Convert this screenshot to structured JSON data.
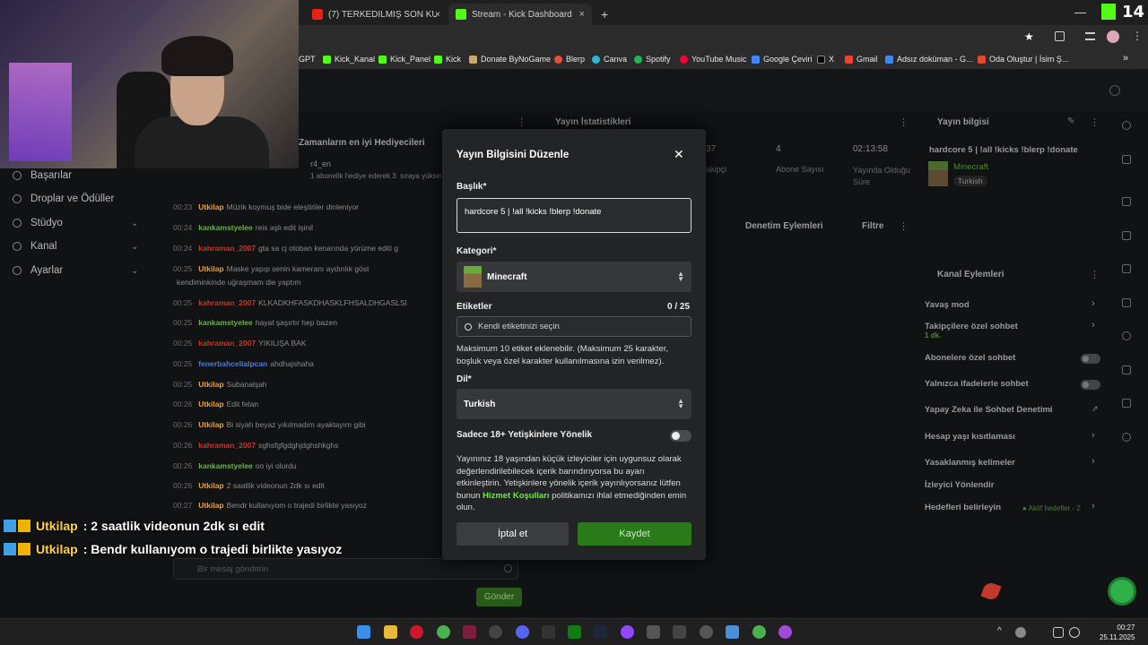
{
  "browser": {
    "tabs": [
      {
        "label": "(7) TERKEDİLMİŞ SON KULEYE V",
        "close": "×"
      },
      {
        "label": "Stream - Kick Dashboard",
        "close": "×"
      }
    ],
    "new_tab": "+",
    "kick_counter": "14",
    "window_controls": {
      "minimize": "—",
      "maximize": "☐",
      "close": "✕"
    },
    "bookmarks": [
      "GPT",
      "Kick_Kanal",
      "Kick_Panel",
      "Kick",
      "Donate ByNoGame",
      "Blerp",
      "Canva",
      "Spotify",
      "YouTube Music",
      "Google Çeviri",
      "X",
      "Gmail",
      "Adsız doküman - G...",
      "Oda Oluştur | İsim Ş..."
    ],
    "bookmarks_more": "»"
  },
  "dashboard": {
    "panels": {
      "gifters": "Zamanların en iyi Hediyecileri",
      "stats": "Yayın İstatistikleri",
      "info": "Yayın bilgisi",
      "moderation": "Denetim Eylemleri",
      "filter": "Filtre",
      "channel_actions": "Kanal Eylemleri"
    },
    "gifter_name": "r4_en",
    "gifter_note": "1 abonelik hediye ederek 3. sıraya yükseldi",
    "stats": [
      {
        "value": "4",
        "label": "Abone Sayısı"
      },
      {
        "value": "02:13:58",
        "label": "Yayında Olduğu Süre"
      }
    ],
    "stats_fragment": {
      "value": "37",
      "label": "akipçi"
    },
    "stream_info": {
      "title": "hardcore 5 | !all !kicks !blerp !donate",
      "category": "Minecraft",
      "language": "Turkish"
    },
    "nav": [
      {
        "label": "Başarılar",
        "chevron": ""
      },
      {
        "label": "Droplar ve Ödüller",
        "chevron": ""
      },
      {
        "label": "Stüdyo",
        "chevron": "⌄"
      },
      {
        "label": "Kanal",
        "chevron": "⌄"
      },
      {
        "label": "Ayarlar",
        "chevron": "⌄"
      }
    ],
    "chat": [
      {
        "time": "00:23",
        "user": "Utkilap",
        "color": "#e8a13a",
        "msg": "Müzik koymuş bide eleştiriler dinleniyor"
      },
      {
        "time": "00:24",
        "user": "kankamstyelee",
        "color": "#6ab04c",
        "msg": "reis aşlı edit işinil"
      },
      {
        "time": "00:24",
        "user": "kahraman_2007",
        "color": "#c0392b",
        "msg": "gta sa cj otoban kenarında yürüme editi g"
      },
      {
        "time": "00:25",
        "user": "Utkilap",
        "color": "#e8a13a",
        "msg": "Maske yapıp senin kameranı aydınlık göst"
      },
      {
        "time": "",
        "user": "",
        "color": "#8a8a8a",
        "msg": "kendiminkinde uğraşmam die yaptım"
      },
      {
        "time": "00:25",
        "user": "kahraman_2007",
        "color": "#c0392b",
        "msg": "KLKADKHFASKDHASKLFHSALDHGASLSI"
      },
      {
        "time": "00:25",
        "user": "kankamstyelee",
        "color": "#6ab04c",
        "msg": "hayat şaşırtır hep bazen"
      },
      {
        "time": "00:25",
        "user": "kahraman_2007",
        "color": "#c0392b",
        "msg": "YIKILIŞA BAK"
      },
      {
        "time": "00:25",
        "user": "fenerbahcelialpcan",
        "color": "#4c7bd9",
        "msg": "ahdhajshaha"
      },
      {
        "time": "00:25",
        "user": "Utkilap",
        "color": "#e8a13a",
        "msg": "Subanalşah"
      },
      {
        "time": "00:26",
        "user": "Utkilap",
        "color": "#e8a13a",
        "msg": "Edit felan"
      },
      {
        "time": "00:26",
        "user": "Utkilap",
        "color": "#e8a13a",
        "msg": "Bi siyah beyaz yıkılmadım ayaktayım gibi"
      },
      {
        "time": "00:26",
        "user": "kahraman_2007",
        "color": "#c0392b",
        "msg": "sghsfgfgdghjdghshkghs"
      },
      {
        "time": "00:26",
        "user": "kankamstyelee",
        "color": "#6ab04c",
        "msg": "oo iyi olurdu"
      },
      {
        "time": "00:26",
        "user": "Utkilap",
        "color": "#e8a13a",
        "msg": "2 saatlik videonun 2dk sı edit"
      },
      {
        "time": "00:27",
        "user": "Utkilap",
        "color": "#e8a13a",
        "msg": "Bendr kullanıyom o trajedi birlikte yasıyoz"
      }
    ],
    "chat_input_placeholder": "Bir mesaj gönderin",
    "chat_send": "Gönder",
    "channel_actions": [
      {
        "label": "Yavaş mod",
        "sub": "",
        "control": "arrow"
      },
      {
        "label": "Takipçilere özel sohbet",
        "sub": "1 dk.",
        "control": "arrow"
      },
      {
        "label": "Abonelere özel sohbet",
        "sub": "",
        "control": "toggle"
      },
      {
        "label": "Yalnızca ifadelerle sohbet",
        "sub": "",
        "control": "toggle"
      },
      {
        "label": "Yapay Zeka ile Sohbet Denetimi",
        "sub": "",
        "control": "icon"
      },
      {
        "label": "Hesap yaşı kısıtlaması",
        "sub": "",
        "control": "arrow"
      },
      {
        "label": "Yasaklanmış kelimeler",
        "sub": "",
        "control": "arrow"
      },
      {
        "label": "İzleyici Yönlendir",
        "sub": "",
        "control": "none"
      },
      {
        "label": "Hedefleri belirleyin",
        "sub": "",
        "control": "arrow"
      }
    ],
    "goal_status": "Aktif hedefler - 2"
  },
  "overlay": {
    "chat": [
      {
        "user": "Utkilap",
        "msg": ": 2 saatlik videonun 2dk sı edit"
      },
      {
        "user": "Utkilap",
        "msg": ": Bendr kullanıyom o trajedi birlikte yasıyoz"
      }
    ]
  },
  "modal": {
    "title": "Yayın Bilgisini Düzenle",
    "close": "✕",
    "title_label": "Başlık*",
    "title_value": "hardcore 5 | !all !kicks !blerp !donate",
    "category_label": "Kategori*",
    "category_value": "Minecraft",
    "tags_label": "Etiketler",
    "tags_count": "0 / 25",
    "tags_placeholder": "Kendi etiketinizi seçin",
    "tags_help": "Maksimum 10 etiket eklenebilir. (Maksimum 25 karakter, boşluk veya özel karakter kullanılmasına izin verilmez).",
    "language_label": "Dil*",
    "language_value": "Turkish",
    "adult_label": "Sadece 18+ Yetişkinlere Yönelik",
    "adult_enabled": false,
    "adult_text_1": "Yayınınız 18 yaşından küçük izleyiciler için uygunsuz olarak değerlendirilebilecek içerik barındırıyorsa bu ayarı etkinleştirin. Yetişkinlere yönelik içerik yayınlıyorsanız lütfen bunun ",
    "adult_link": "Hizmet Koşulları",
    "adult_text_2": " politikamızı ihlal etmediğinden emin olun.",
    "cancel": "İptal et",
    "save": "Kaydet"
  },
  "taskbar": {
    "time": "00:27",
    "date": "25.11.2025"
  },
  "colors": {
    "kick_green": "#53fc18",
    "modal_bg": "#232426",
    "save_btn": "#2b7a1a"
  }
}
